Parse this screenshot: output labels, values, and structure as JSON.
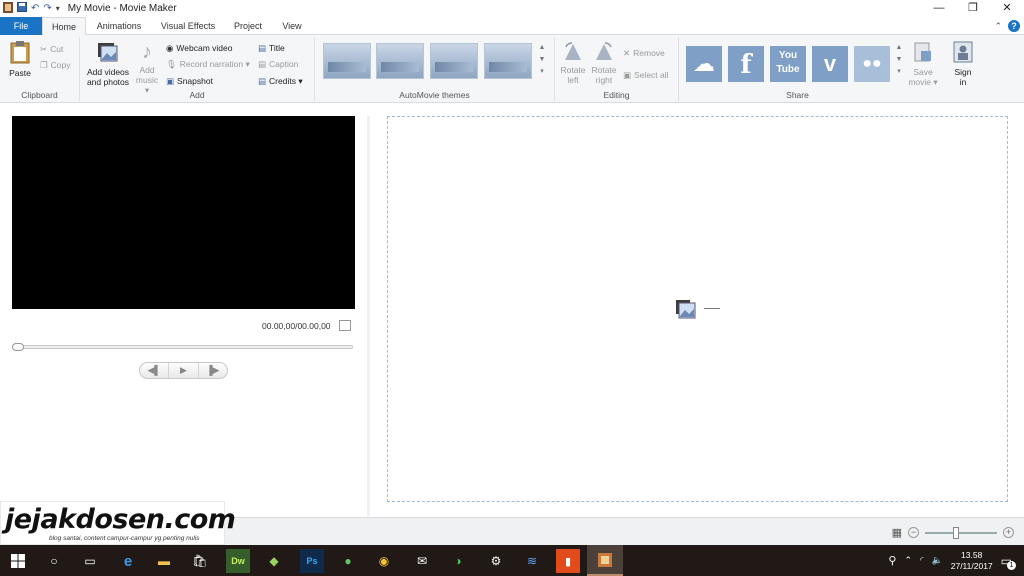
{
  "window": {
    "title": "My Movie - Movie Maker",
    "controls": [
      "—",
      "❐",
      "✕"
    ]
  },
  "tabs": [
    "File",
    "Home",
    "Animations",
    "Visual Effects",
    "Project",
    "View"
  ],
  "ribbon": {
    "clipboard": {
      "label": "Clipboard",
      "paste": "Paste",
      "cut": "Cut",
      "copy": "Copy"
    },
    "add": {
      "label": "Add",
      "add_videos_line1": "Add videos",
      "add_videos_line2": "and photos",
      "add_music_line1": "Add",
      "add_music_line2": "music ▾",
      "webcam_video": "Webcam video",
      "record_narration": "Record narration ▾",
      "snapshot": "Snapshot",
      "title": "Title",
      "caption": "Caption",
      "credits": "Credits ▾"
    },
    "themes": {
      "label": "AutoMovie themes"
    },
    "editing": {
      "label": "Editing",
      "rotate_left_line1": "Rotate",
      "rotate_left_line2": "left",
      "rotate_right_line1": "Rotate",
      "rotate_right_line2": "right",
      "remove": "Remove",
      "select_all": "Select all"
    },
    "share": {
      "label": "Share",
      "youtube": "You Tube",
      "save_movie_line1": "Save",
      "save_movie_line2": "movie ▾",
      "sign_in_line1": "Sign",
      "sign_in_line2": "in"
    }
  },
  "player": {
    "timecode": "00.00,00/00.00,00",
    "controls": [
      "◀▌",
      "▶",
      "▐▶"
    ]
  },
  "watermark": {
    "brand": "jejakdosen.com",
    "tagline": "blog santai, content campur-campur yg penting nulis"
  },
  "taskbar": {
    "clock_time": "13.58",
    "clock_date": "27/11/2017",
    "notification_count": "1"
  },
  "colors": {
    "file_tab": "#1a74c3",
    "ribbon_bg": "#f5f6f7",
    "share_tile": "#7f9fc6",
    "storyboard_border": "#9dbbe0",
    "taskbar_bg": "#211915"
  }
}
